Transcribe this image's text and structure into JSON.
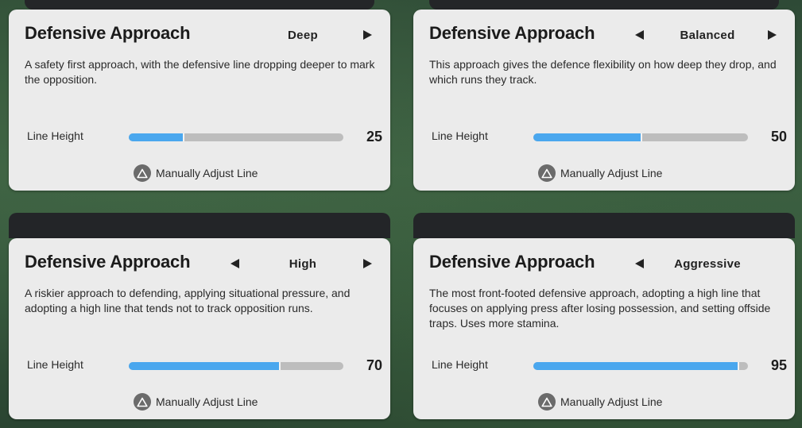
{
  "panels": [
    {
      "title": "Defensive Approach",
      "option": "Deep",
      "description": "A safety first approach, with the defensive line dropping deeper to mark the opposition.",
      "line_height_label": "Line Height",
      "line_height_value": "25",
      "line_height_fraction": 0.25,
      "manual_label": "Manually Adjust Line",
      "has_left_arrow": false,
      "has_right_arrow": true
    },
    {
      "title": "Defensive Approach",
      "option": "Balanced",
      "description": "This approach gives the defence flexibility on how deep they drop, and which runs they track.",
      "line_height_label": "Line Height",
      "line_height_value": "50",
      "line_height_fraction": 0.5,
      "manual_label": "Manually Adjust Line",
      "has_left_arrow": true,
      "has_right_arrow": true
    },
    {
      "title": "Defensive Approach",
      "option": "High",
      "description": "A riskier approach to defending, applying situational pressure, and adopting a high line that tends not to track opposition runs.",
      "line_height_label": "Line Height",
      "line_height_value": "70",
      "line_height_fraction": 0.7,
      "manual_label": "Manually Adjust Line",
      "has_left_arrow": true,
      "has_right_arrow": true
    },
    {
      "title": "Defensive Approach",
      "option": "Aggressive",
      "description": "The most front-footed defensive approach, adopting a high line that focuses on applying press after losing possession, and setting offside traps. Uses more stamina.",
      "line_height_label": "Line Height",
      "line_height_value": "95",
      "line_height_fraction": 0.95,
      "manual_label": "Manually Adjust Line",
      "has_left_arrow": true,
      "has_right_arrow": false
    }
  ],
  "colors": {
    "bar_fill": "#4aa7ee",
    "bar_track": "#bdbdbd",
    "panel_bg": "#ebebeb",
    "triangle_button": "#6b6b6b"
  },
  "icons": {
    "left_arrow": "caret-left-icon",
    "right_arrow": "caret-right-icon",
    "manual_button": "triangle-button-icon"
  }
}
